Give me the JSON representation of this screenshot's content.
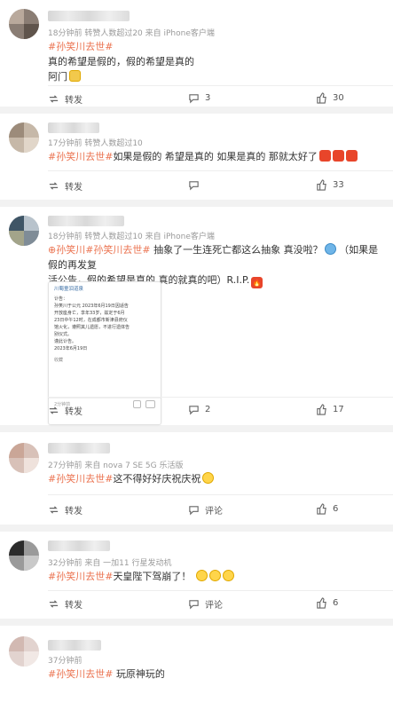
{
  "posts": [
    {
      "meta": "18分钟前  转赞人数超过20  来自 iPhone客户端",
      "hashtag": "#孙笑川去世#",
      "lines": [
        "真的希望是假的，假的希望是真的",
        "阿门"
      ],
      "actions": {
        "repost": "转发",
        "comments": "3",
        "likes": "30"
      }
    },
    {
      "meta": "17分钟前  转赞人数超过10",
      "hashtag": "#孙笑川去世#",
      "text": "如果是假的 希望是真的 如果是真的 那就太好了",
      "actions": {
        "repost": "转发",
        "comments": "",
        "likes": "33"
      }
    },
    {
      "meta": "18分钟前  转赞人数超过10  来自 iPhone客户端",
      "hashtag": "孙笑川#孙笑川去世#",
      "line1": "抽象了一生连死亡都这么抽象 真没啦？",
      "line1b": "（如果是假的再发复",
      "line2": "活公告，假的希望是真的 真的就真的吧）R.I.P.",
      "card": {
        "source": "川蜀童泪道泉",
        "lines": [
          "讣告：",
          "孙笑川于公元 2023年6月19日因适告",
          "开放座身亡，享年33岁，兹定于6月",
          "23日中午12时，在成都市新津县府仪",
          "馆火化，遵照其儿遗愿，不进行遗体告",
          "别仪式。",
          "谨此讣告。",
          "2023年6月19日"
        ],
        "footer": "收藏",
        "count": "2分钟前"
      },
      "actions": {
        "repost": "转发",
        "comments": "2",
        "likes": "17"
      }
    },
    {
      "meta": "27分钟前  来自 nova 7 SE 5G 乐活版",
      "hashtag": "#孙笑川去世#",
      "text": "这不得好好庆祝庆祝",
      "actions": {
        "repost": "转发",
        "comments": "评论",
        "likes": "6"
      }
    },
    {
      "meta": "32分钟前  来自 一加11 行星发动机",
      "hashtag": "#孙笑川去世#",
      "text": "天皇陛下驾崩了！",
      "actions": {
        "repost": "转发",
        "comments": "评论",
        "likes": "6"
      }
    },
    {
      "meta": "37分钟前",
      "hashtag": "#孙笑川去世#",
      "text": "玩原神玩的",
      "actions": {
        "repost": "",
        "comments": "",
        "likes": ""
      }
    }
  ],
  "colors": {
    "hashtag": "#eb7350",
    "meta": "#9a9a9a",
    "background": "#f2f2f2"
  }
}
